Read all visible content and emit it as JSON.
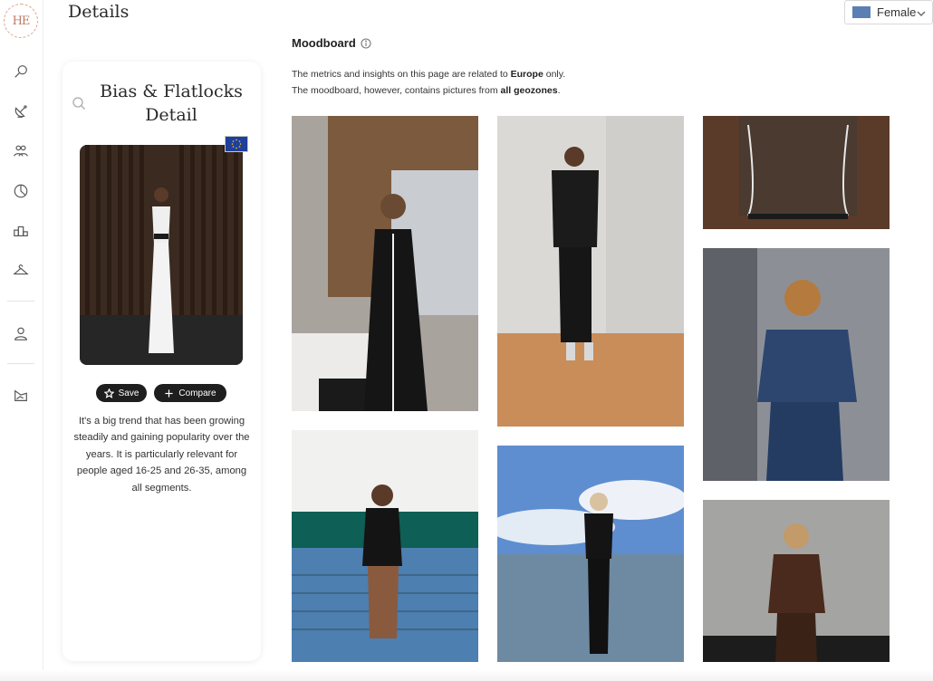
{
  "header": {
    "title": "Details",
    "gender_select": {
      "value": "Female",
      "swatch_color": "#5b7fb3"
    }
  },
  "logo": {
    "text": "HE"
  },
  "sidebar": {
    "items": [
      {
        "icon": "search-icon"
      },
      {
        "icon": "satellite-icon"
      },
      {
        "icon": "community-icon"
      },
      {
        "icon": "pie-chart-icon"
      },
      {
        "icon": "podium-icon"
      },
      {
        "icon": "hanger-icon"
      },
      {
        "icon": "user-icon"
      },
      {
        "icon": "report-icon"
      }
    ]
  },
  "card": {
    "title_line1": "Bias & Flatlocks",
    "title_line2": "Detail",
    "region_flag": "eu-flag-icon",
    "save_label": "Save",
    "compare_label": "Compare",
    "description": "It's a big trend that has been growing steadily and gaining popularity over the years. It is particularly relevant for people aged 16-25 and 26-35, among all segments."
  },
  "moodboard": {
    "title": "Moodboard",
    "line1_prefix": "The metrics and insights on this page are related to ",
    "line1_bold": "Europe",
    "line1_suffix": " only.",
    "line2_prefix": "The moodboard, however, contains pictures from ",
    "line2_bold": "all geozones",
    "line2_suffix": ".",
    "images": [
      {
        "alt": "Woman in black dress with white piping taking mirror selfie in phone store"
      },
      {
        "alt": "Woman in black tracksuit with white piping standing on wooden floor"
      },
      {
        "alt": "Brown leather jacket with white piping detail"
      },
      {
        "alt": "Woman with tennis racket in black two-piece at tennis net"
      },
      {
        "alt": "Woman in black set with white piping by the sea"
      },
      {
        "alt": "Woman in denim jacket and jeans in elevator"
      },
      {
        "alt": "Woman in brown jacket and trousers against concrete wall"
      }
    ]
  },
  "colors": {
    "accent": "#1e1e1e",
    "flag_blue": "#1f3f9a"
  }
}
